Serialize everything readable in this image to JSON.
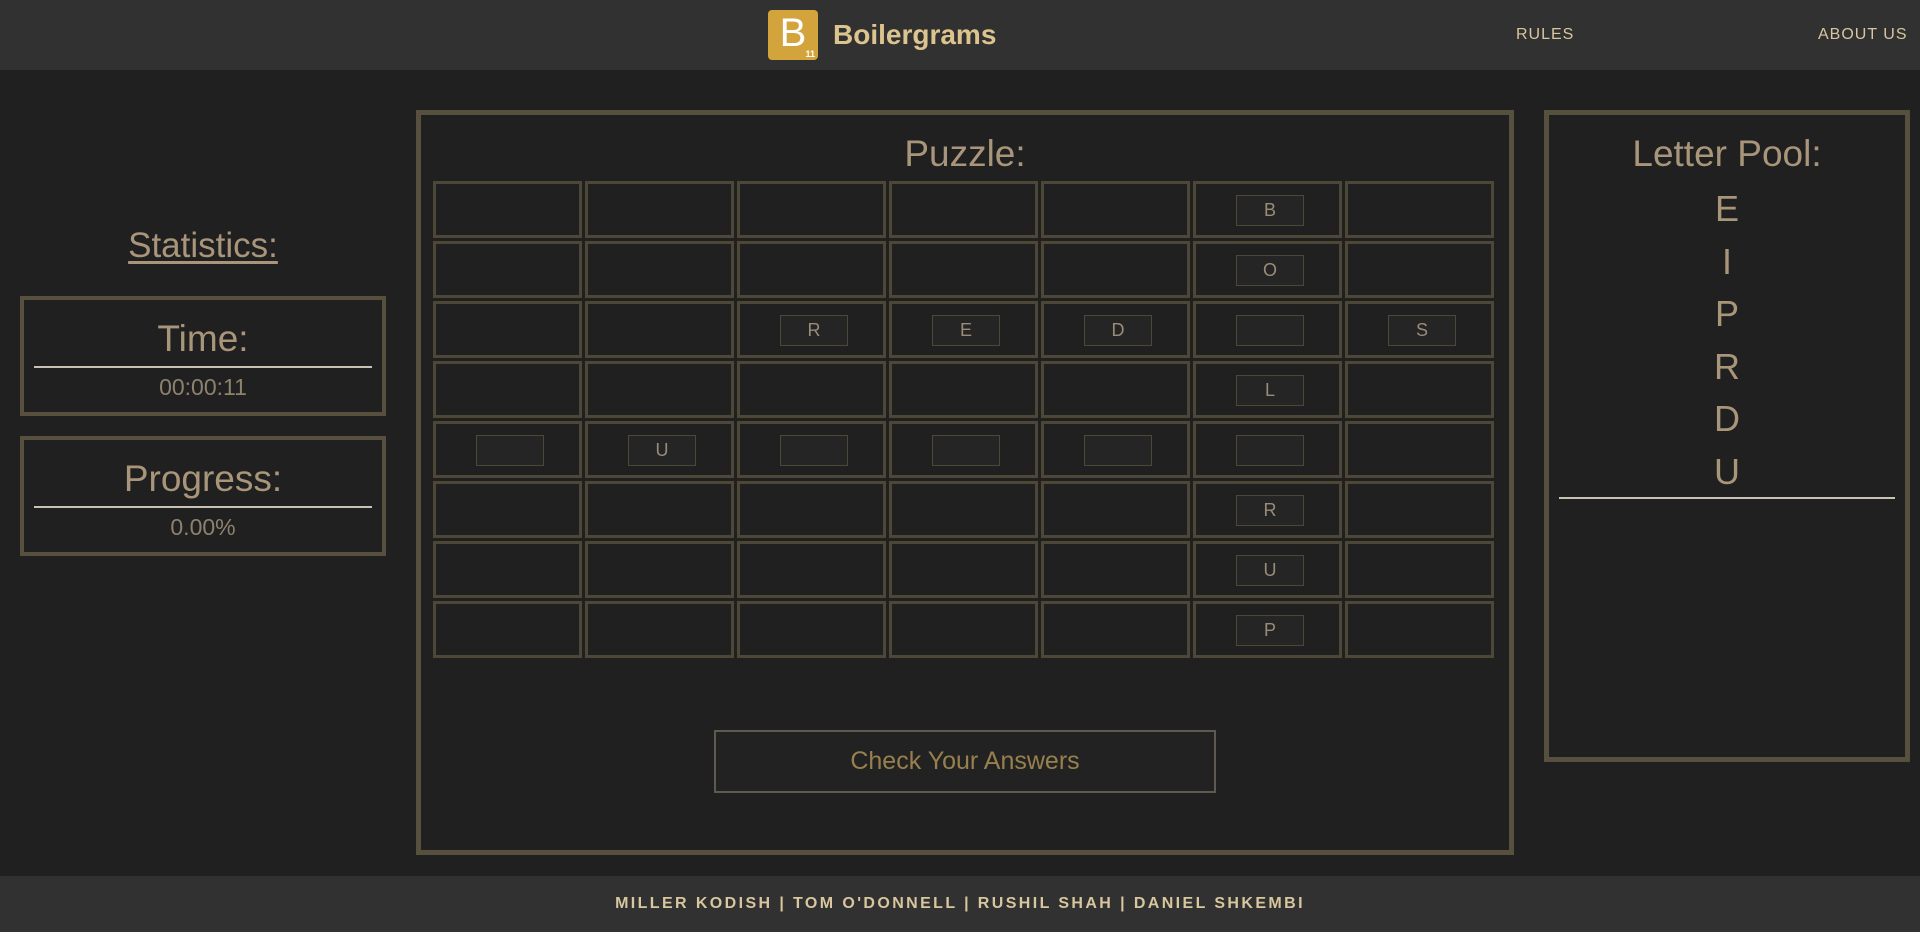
{
  "header": {
    "logo_letter": "B",
    "logo_subscript": "11",
    "brand": "Boilergrams",
    "nav": {
      "rules": "RULES",
      "about": "ABOUT US"
    }
  },
  "statistics": {
    "title": "Statistics:",
    "time_label": "Time:",
    "time_value": "00:00:11",
    "progress_label": "Progress:",
    "progress_value": "0.00%"
  },
  "puzzle": {
    "title": "Puzzle:",
    "columns": 7,
    "rows": [
      [
        null,
        null,
        null,
        null,
        null,
        "B",
        null
      ],
      [
        null,
        null,
        null,
        null,
        null,
        "O",
        null
      ],
      [
        null,
        null,
        "R",
        "E",
        "D",
        "",
        "S"
      ],
      [
        null,
        null,
        null,
        null,
        null,
        "L",
        null
      ],
      [
        "",
        "U",
        "",
        "",
        "",
        "",
        null
      ],
      [
        null,
        null,
        null,
        null,
        null,
        "R",
        null
      ],
      [
        null,
        null,
        null,
        null,
        null,
        "U",
        null
      ],
      [
        null,
        null,
        null,
        null,
        null,
        "P",
        null
      ]
    ],
    "check_button": "Check Your Answers"
  },
  "letter_pool": {
    "title": "Letter Pool:",
    "letters": [
      "E",
      "I",
      "P",
      "R",
      "D",
      "U"
    ]
  },
  "footer": {
    "credits": "MILLER KODISH | TOM O'DONNELL | RUSHIL SHAH | DANIEL SHKEMBI"
  },
  "colors": {
    "background": "#202020",
    "bar": "#313131",
    "accent": "#d4a43c",
    "border": "#58503f",
    "text": "#a8957a"
  }
}
